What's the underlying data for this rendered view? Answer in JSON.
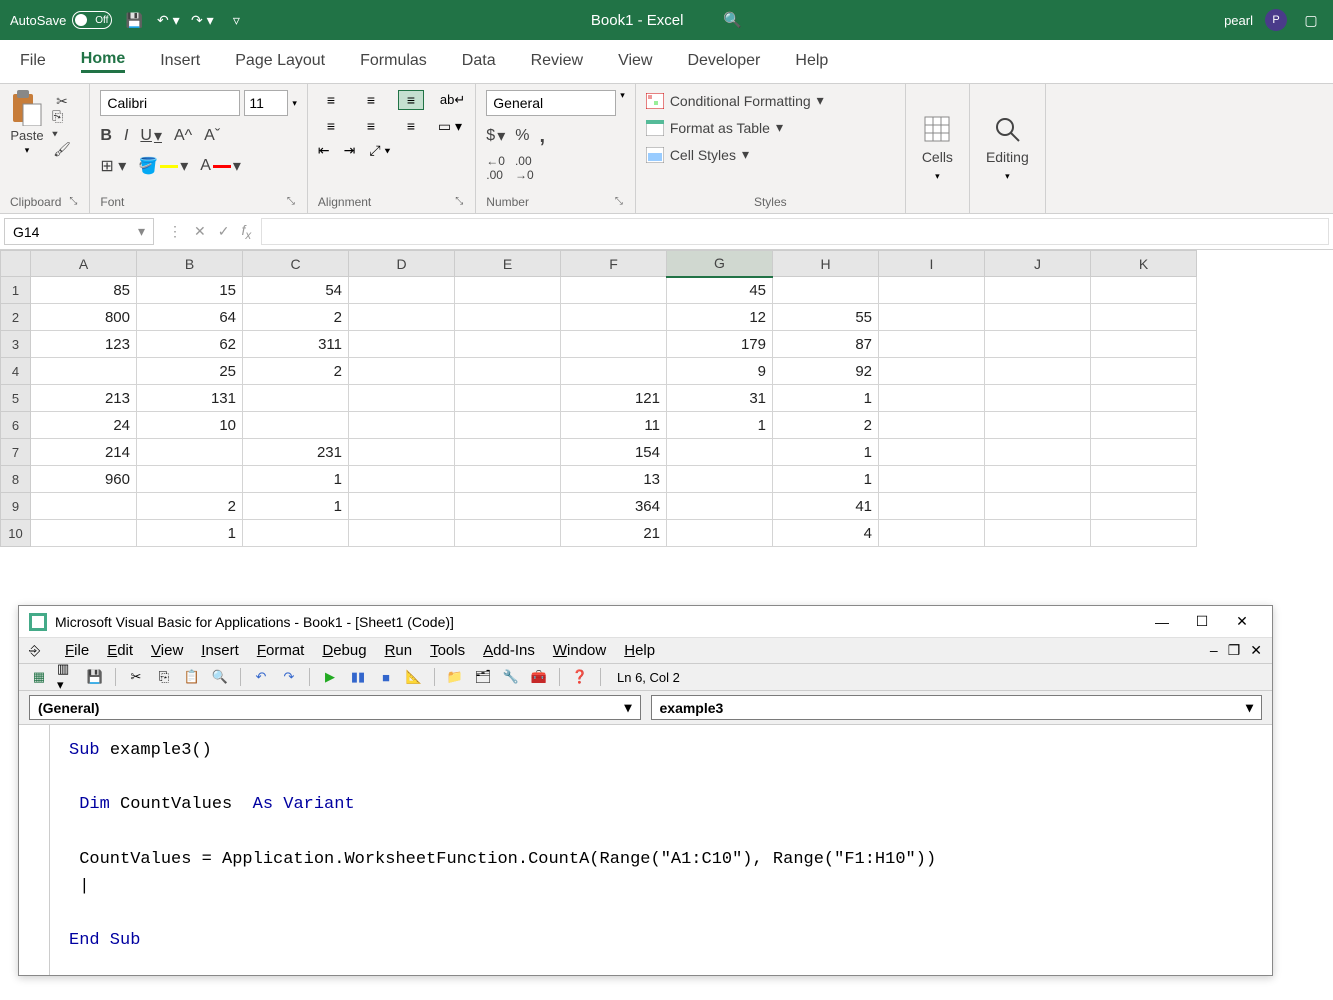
{
  "titlebar": {
    "autosave": "AutoSave",
    "autosave_state": "Off",
    "title": "Book1 - Excel",
    "user": "pearl",
    "user_initial": "P"
  },
  "tabs": [
    "File",
    "Home",
    "Insert",
    "Page Layout",
    "Formulas",
    "Data",
    "Review",
    "View",
    "Developer",
    "Help"
  ],
  "active_tab": "Home",
  "ribbon": {
    "clipboard": {
      "paste": "Paste",
      "label": "Clipboard"
    },
    "font": {
      "name": "Calibri",
      "size": "11",
      "label": "Font",
      "bold": "B",
      "italic": "I",
      "underline": "U"
    },
    "alignment": {
      "label": "Alignment",
      "wrap": "ab"
    },
    "number": {
      "format": "General",
      "label": "Number",
      "currency": "$",
      "percent": "%",
      "comma": ","
    },
    "styles": {
      "cond": "Conditional Formatting",
      "table": "Format as Table",
      "cell": "Cell Styles",
      "label": "Styles"
    },
    "cells": {
      "label": "Cells"
    },
    "editing": {
      "label": "Editing"
    }
  },
  "namebox": "G14",
  "formula": "",
  "columns": [
    "A",
    "B",
    "C",
    "D",
    "E",
    "F",
    "G",
    "H",
    "I",
    "J",
    "K"
  ],
  "rows": [
    1,
    2,
    3,
    4,
    5,
    6,
    7,
    8,
    9,
    10
  ],
  "grid": [
    {
      "A": "85",
      "B": "15",
      "C": "54",
      "D": "",
      "E": "",
      "F": "",
      "G": "45",
      "H": "",
      "I": "",
      "J": "",
      "K": ""
    },
    {
      "A": "800",
      "B": "64",
      "C": "2",
      "D": "",
      "E": "",
      "F": "",
      "G": "12",
      "H": "55",
      "I": "",
      "J": "",
      "K": ""
    },
    {
      "A": "123",
      "B": "62",
      "C": "311",
      "D": "",
      "E": "",
      "F": "",
      "G": "179",
      "H": "87",
      "I": "",
      "J": "",
      "K": ""
    },
    {
      "A": "",
      "B": "25",
      "C": "2",
      "D": "",
      "E": "",
      "F": "",
      "G": "9",
      "H": "92",
      "I": "",
      "J": "",
      "K": ""
    },
    {
      "A": "213",
      "B": "131",
      "C": "",
      "D": "",
      "E": "",
      "F": "121",
      "G": "31",
      "H": "1",
      "I": "",
      "J": "",
      "K": ""
    },
    {
      "A": "24",
      "B": "10",
      "C": "",
      "D": "",
      "E": "",
      "F": "11",
      "G": "1",
      "H": "2",
      "I": "",
      "J": "",
      "K": ""
    },
    {
      "A": "214",
      "B": "",
      "C": "231",
      "D": "",
      "E": "",
      "F": "154",
      "G": "",
      "H": "1",
      "I": "",
      "J": "",
      "K": ""
    },
    {
      "A": "960",
      "B": "",
      "C": "1",
      "D": "",
      "E": "",
      "F": "13",
      "G": "",
      "H": "1",
      "I": "",
      "J": "",
      "K": ""
    },
    {
      "A": "",
      "B": "2",
      "C": "1",
      "D": "",
      "E": "",
      "F": "364",
      "G": "",
      "H": "41",
      "I": "",
      "J": "",
      "K": ""
    },
    {
      "A": "",
      "B": "1",
      "C": "",
      "D": "",
      "E": "",
      "F": "21",
      "G": "",
      "H": "4",
      "I": "",
      "J": "",
      "K": ""
    }
  ],
  "vba": {
    "title": "Microsoft Visual Basic for Applications - Book1 - [Sheet1 (Code)]",
    "menu": [
      "File",
      "Edit",
      "View",
      "Insert",
      "Format",
      "Debug",
      "Run",
      "Tools",
      "Add-Ins",
      "Window",
      "Help"
    ],
    "status": "Ln 6, Col 2",
    "dropdown_left": "(General)",
    "dropdown_right": "example3",
    "code": {
      "l1a": "Sub ",
      "l1b": "example3()",
      "l2a": " Dim ",
      "l2b": "CountValues  ",
      "l2c": "As Variant",
      "l3": " CountValues = Application.WorksheetFunction.CountA(Range(\"A1:C10\"), Range(\"F1:H10\"))",
      "l4": " |",
      "l5": "End Sub"
    }
  }
}
